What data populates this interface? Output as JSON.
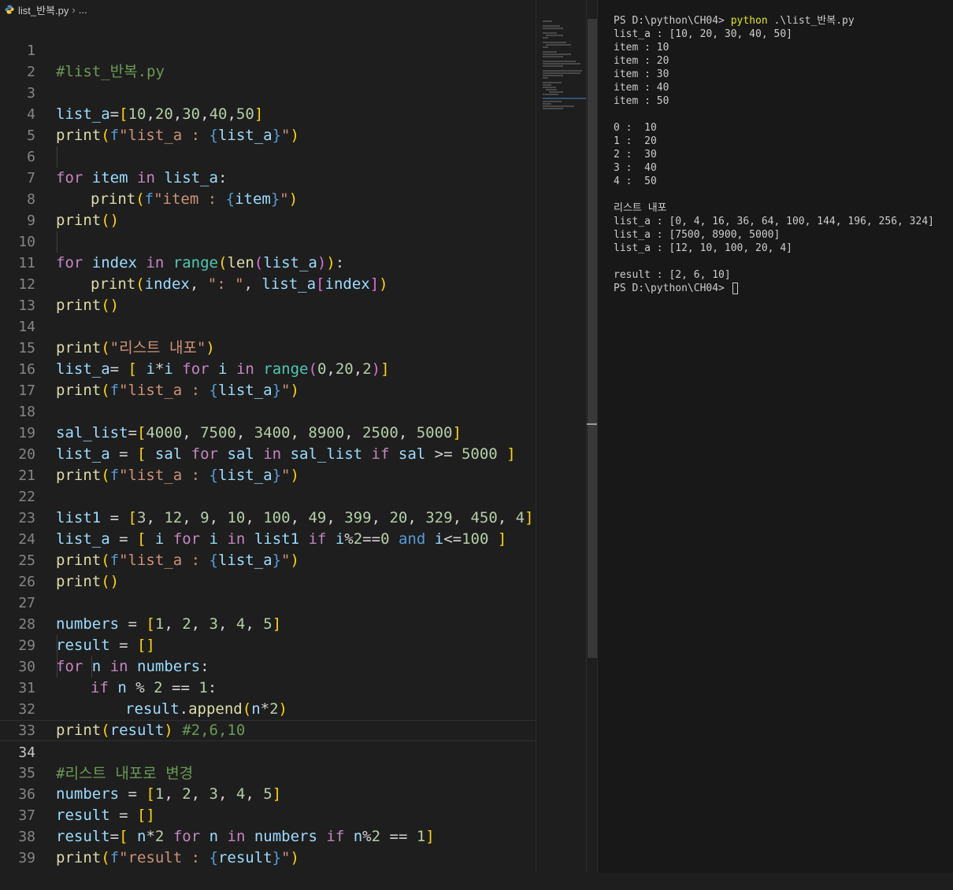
{
  "breadcrumb": {
    "file": "list_반복.py",
    "trail": "..."
  },
  "editor": {
    "line_numbers": [
      "1",
      "2",
      "3",
      "4",
      "5",
      "6",
      "7",
      "8",
      "9",
      "10",
      "11",
      "12",
      "13",
      "14",
      "15",
      "16",
      "17",
      "18",
      "19",
      "20",
      "21",
      "22",
      "23",
      "24",
      "25",
      "26",
      "27",
      "28",
      "29",
      "30",
      "31",
      "32",
      "33",
      "34",
      "35",
      "36",
      "37",
      "38",
      "39"
    ],
    "code": {
      "l1": "#list_반복.py",
      "l3": "list_a=[10,20,30,40,50]",
      "l4": "print(f\"list_a : {list_a}\")",
      "l6": "for item in list_a:",
      "l7": "print(f\"item : {item}\")",
      "l8": "print()",
      "l10": "for index in range(len(list_a)):",
      "l11": "print(index, \": \", list_a[index])",
      "l12": "print()",
      "l14": "print(\"리스트 내포\")",
      "l15": "list_a= [ i*i for i in range(0,20,2)]",
      "l16": "print(f\"list_a : {list_a}\")",
      "l18": "sal_list=[4000, 7500, 3400, 8900, 2500, 5000]",
      "l19": "list_a = [ sal for sal in sal_list if sal >= 5000 ]",
      "l20": "print(f\"list_a : {list_a}\")",
      "l22": "list1 = [3, 12, 9, 10, 100, 49, 399, 20, 329, 450, 4]",
      "l23": "list_a = [ i for i in list1 if i%2==0 and i<=100 ]",
      "l24": "print(f\"list_a : {list_a}\")",
      "l25": "print()",
      "l27": "numbers = [1, 2, 3, 4, 5]",
      "l28": "result = []",
      "l29": "for n in numbers:",
      "l30": "if n % 2 == 1:",
      "l31": "result.append(n*2)",
      "l32": "print(result) #2,6,10",
      "l34": "#리스트 내포로 변경",
      "l35": "numbers = [1, 2, 3, 4, 5]",
      "l36": "result = []",
      "l37": "result=[ n*2 for n in numbers if n%2 == 1]",
      "l38": "print(f\"result : {result}\")"
    },
    "current_line": "34"
  },
  "terminal": {
    "prompt": "PS D:\\python\\CH04>",
    "command_exe": "python",
    "command_arg": ".\\list_반복.py",
    "output": [
      "list_a : [10, 20, 30, 40, 50]",
      "item : 10",
      "item : 20",
      "item : 30",
      "item : 40",
      "item : 50",
      "",
      "0 :  10",
      "1 :  20",
      "2 :  30",
      "3 :  40",
      "4 :  50",
      "",
      "리스트 내포",
      "list_a : [0, 4, 16, 36, 64, 100, 144, 196, 256, 324]",
      "list_a : [7500, 8900, 5000]",
      "list_a : [12, 10, 100, 20, 4]",
      "",
      "result : [2, 6, 10]"
    ]
  },
  "colors": {
    "keyword": "#569cd6",
    "control": "#c586c0",
    "function": "#dcdcaa",
    "variable": "#9cdcfe",
    "number": "#b5cea8",
    "string": "#ce9178",
    "comment": "#6a9955",
    "background": "#1e1e1e",
    "terminal_background": "#181818"
  },
  "icons": [
    "python-file-icon",
    "chevron-right-icon",
    "terminal-cursor"
  ]
}
